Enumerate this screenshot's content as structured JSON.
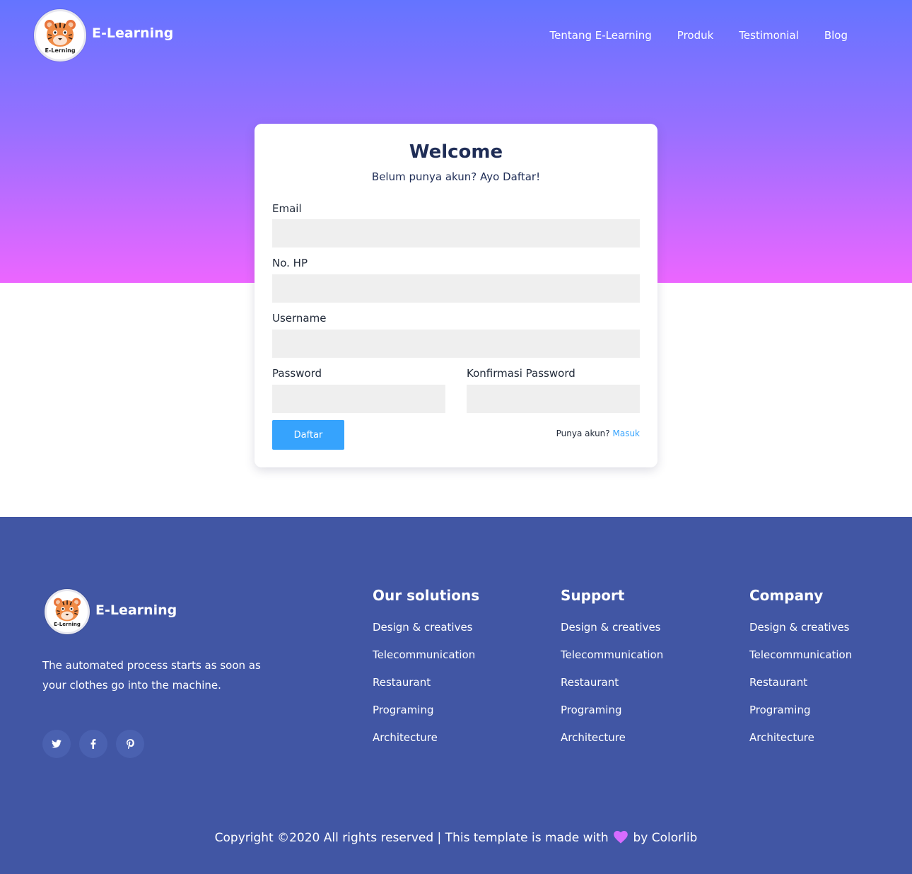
{
  "brand": {
    "name": "E-Learning",
    "logo_caption": "E-Lerning"
  },
  "nav": {
    "items": [
      {
        "label": "Tentang E-Learning"
      },
      {
        "label": "Produk"
      },
      {
        "label": "Testimonial"
      },
      {
        "label": "Blog"
      }
    ]
  },
  "form": {
    "title": "Welcome",
    "subtitle": "Belum punya akun? Ayo Daftar!",
    "email_label": "Email",
    "email_value": "",
    "phone_label": "No. HP",
    "phone_value": "",
    "username_label": "Username",
    "username_value": "",
    "password_label": "Password",
    "password_value": "",
    "confirm_label": "Konfirmasi Password",
    "confirm_value": "",
    "submit_label": "Daftar",
    "login_prompt": "Punya akun?",
    "login_link": "Masuk"
  },
  "footer": {
    "brand_name": "E-Learning",
    "logo_caption": "E-Lerning",
    "description": "The automated process starts as soon as your clothes go into the machine.",
    "social": [
      "twitter-icon",
      "facebook-icon",
      "pinterest-icon"
    ],
    "columns": [
      {
        "title": "Our solutions",
        "links": [
          "Design & creatives",
          "Telecommunication",
          "Restaurant",
          "Programing",
          "Architecture"
        ]
      },
      {
        "title": "Support",
        "links": [
          "Design & creatives",
          "Telecommunication",
          "Restaurant",
          "Programing",
          "Architecture"
        ]
      },
      {
        "title": "Company",
        "links": [
          "Design & creatives",
          "Telecommunication",
          "Restaurant",
          "Programing",
          "Architecture"
        ]
      }
    ],
    "copyright_before": "Copyright ©2020 All rights reserved | This template is made with",
    "copyright_after": "by Colorlib"
  },
  "colors": {
    "hero_top": "#6474ff",
    "hero_bottom": "#ec66ff",
    "accent": "#36a3fd",
    "footer_bg": "#4156a4",
    "heart": "#d66cff"
  }
}
